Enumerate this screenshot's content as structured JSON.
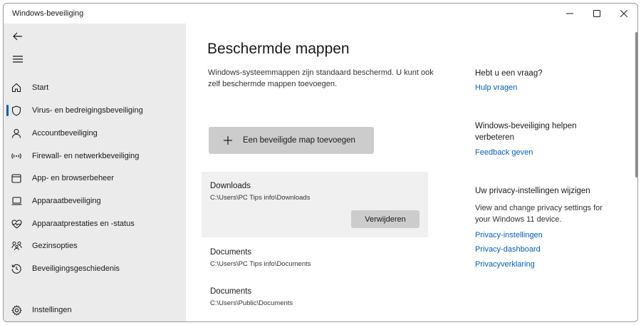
{
  "window": {
    "title": "Windows-beveiliging"
  },
  "sidebar": {
    "items": [
      {
        "label": "Start",
        "icon": "home-icon"
      },
      {
        "label": "Virus- en bedreigingsbeveiliging",
        "icon": "shield-icon",
        "active": true
      },
      {
        "label": "Accountbeveiliging",
        "icon": "person-icon"
      },
      {
        "label": "Firewall- en netwerkbeveiliging",
        "icon": "wifi-icon"
      },
      {
        "label": "App- en browserbeheer",
        "icon": "browser-icon"
      },
      {
        "label": "Apparaatbeveiliging",
        "icon": "laptop-icon"
      },
      {
        "label": "Apparaatprestaties en -status",
        "icon": "heart-icon"
      },
      {
        "label": "Gezinsopties",
        "icon": "family-icon"
      },
      {
        "label": "Beveiligingsgeschiedenis",
        "icon": "history-icon"
      }
    ],
    "settings_label": "Instellingen"
  },
  "main": {
    "title": "Beschermde mappen",
    "description": "Windows-systeemmappen zijn standaard beschermd. U kunt ook zelf beschermde mappen toevoegen.",
    "add_button": "Een beveiligde map toevoegen",
    "folders": [
      {
        "name": "Downloads",
        "path": "C:\\Users\\PC Tips info\\Downloads",
        "remove_label": "Verwijderen"
      },
      {
        "name": "Documents",
        "path": "C:\\Users\\PC Tips info\\Documents"
      },
      {
        "name": "Documents",
        "path": "C:\\Users\\Public\\Documents"
      }
    ]
  },
  "side_panel": {
    "question_heading": "Hebt u een vraag?",
    "help_link": "Hulp vragen",
    "improve_heading": "Windows-beveiliging helpen verbeteren",
    "feedback_link": "Feedback geven",
    "privacy_heading": "Uw privacy-instellingen wijzigen",
    "privacy_text": "View and change privacy settings for your Windows 11 device.",
    "privacy_links": [
      "Privacy-instellingen",
      "Privacy-dashboard",
      "Privacyverklaring"
    ]
  },
  "colors": {
    "accent": "#005fb8",
    "sidebar_bg": "#ebebeb",
    "button_bg": "#cccccc"
  }
}
